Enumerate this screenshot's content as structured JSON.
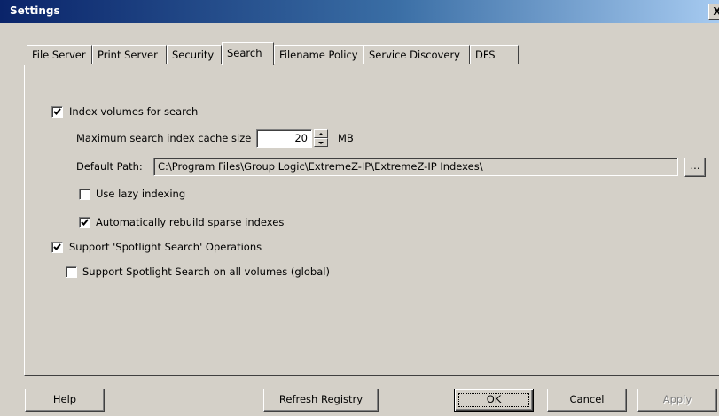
{
  "window": {
    "title": "Settings",
    "close_glyph": "X"
  },
  "tabs": [
    {
      "label": "File Server",
      "active": false
    },
    {
      "label": "Print Server",
      "active": false
    },
    {
      "label": "Security",
      "active": false
    },
    {
      "label": "Search",
      "active": true
    },
    {
      "label": "Filename Policy",
      "active": false
    },
    {
      "label": "Service Discovery",
      "active": false
    },
    {
      "label": "DFS",
      "active": false
    }
  ],
  "search": {
    "index_volumes": {
      "label": "Index volumes for search",
      "checked": true
    },
    "cache_size": {
      "label": "Maximum search index cache size",
      "value": "20",
      "unit": "MB"
    },
    "default_path": {
      "label": "Default Path:",
      "value": "C:\\Program Files\\Group Logic\\ExtremeZ-IP\\ExtremeZ-IP Indexes\\",
      "browse_label": "..."
    },
    "lazy_indexing": {
      "label": "Use lazy indexing",
      "checked": false
    },
    "rebuild_sparse": {
      "label": "Automatically rebuild sparse indexes",
      "checked": true
    },
    "spotlight_ops": {
      "label": "Support 'Spotlight Search' Operations",
      "checked": true
    },
    "spotlight_global": {
      "label": "Support Spotlight Search on all volumes (global)",
      "checked": false
    }
  },
  "footer": {
    "help_label": "Help",
    "refresh_label": "Refresh Registry",
    "ok_label": "OK",
    "cancel_label": "Cancel",
    "apply_label": "Apply"
  }
}
